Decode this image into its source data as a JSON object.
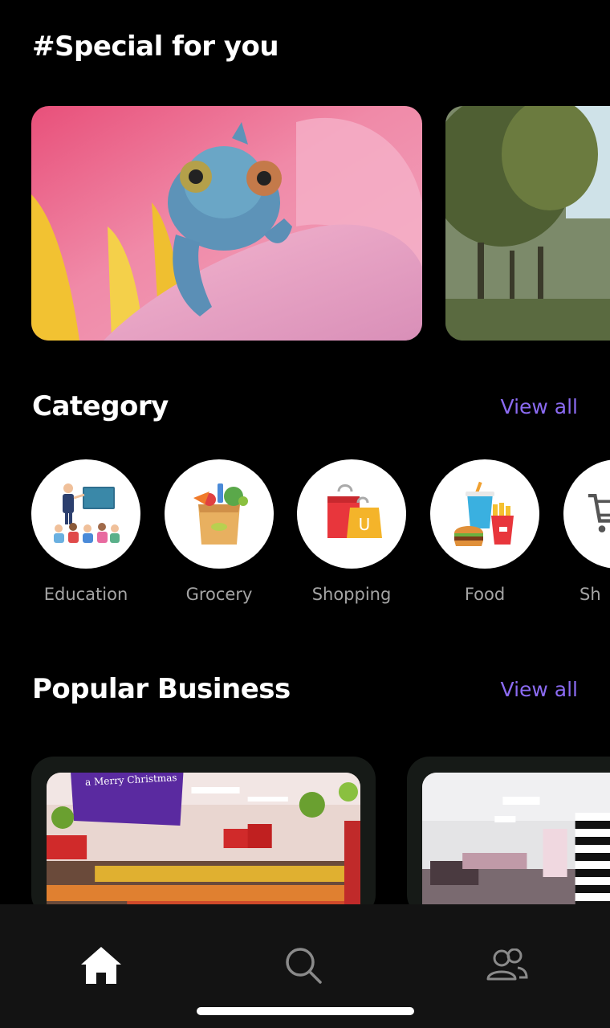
{
  "special": {
    "title": "#Special for you",
    "cards": [
      {
        "image": "chameleon-on-pink-flower"
      },
      {
        "image": "trees-and-person-outdoors"
      }
    ]
  },
  "category": {
    "title": "Category",
    "view_all": "View all",
    "items": [
      {
        "label": "Education",
        "icon": "education-icon"
      },
      {
        "label": "Grocery",
        "icon": "grocery-icon"
      },
      {
        "label": "Shopping",
        "icon": "shopping-bags-icon"
      },
      {
        "label": "Food",
        "icon": "fast-food-icon"
      },
      {
        "label": "Sh",
        "icon": "shopping-cart-icon"
      }
    ]
  },
  "popular": {
    "title": "Popular Business",
    "view_all": "View all",
    "cards": [
      {
        "image": "supermarket-interior",
        "sign_text": "a Merry Christmas"
      },
      {
        "image": "store-interior"
      }
    ]
  },
  "nav": {
    "items": [
      {
        "icon": "home-icon",
        "active": true
      },
      {
        "icon": "search-icon",
        "active": false
      },
      {
        "icon": "people-icon",
        "active": false
      }
    ]
  },
  "colors": {
    "accent": "#8b6bf2",
    "background": "#000000",
    "nav_background": "#131313",
    "label": "#a4a4a4"
  }
}
